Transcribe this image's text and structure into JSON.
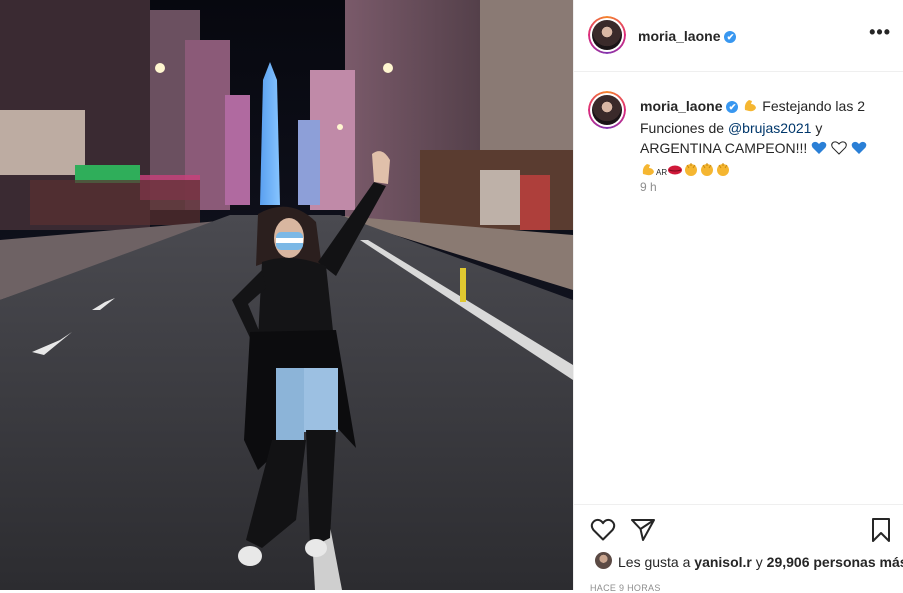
{
  "post": {
    "username": "moria_laone",
    "verified_mark": "✔",
    "more_icon": "more-icon",
    "caption_part1": "Festejando las 2 Funciones de",
    "caption_mention": "@brujas2021",
    "caption_part2": "y ARGENTINA CAMPEON!!!",
    "caption_flag": "AR",
    "time_ago": "9 h",
    "likes_prefix": "Les gusta a",
    "likes_user": "yanisol.r",
    "likes_join": "y",
    "likes_count": "29,906 personas más",
    "date": "HACE 9 HORAS"
  },
  "icons": [
    "heart-icon",
    "share-icon",
    "bookmark-icon",
    "verified-icon"
  ],
  "colors": {
    "accent": "#3897f0",
    "mention": "#00376b",
    "muted": "#8e8e8e",
    "text": "#262626"
  }
}
